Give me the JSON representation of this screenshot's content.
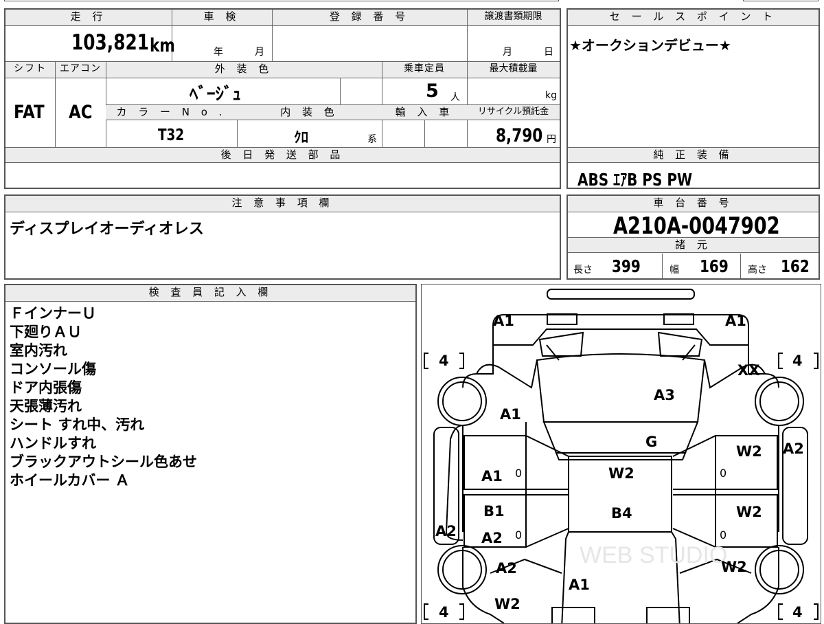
{
  "mileage": {
    "header": "走 行",
    "value": "103,821",
    "unit": "km"
  },
  "inspection": {
    "header": "車 検",
    "year_label": "年",
    "month_label": "月"
  },
  "registration": {
    "header": "登 録 番 号",
    "value": ""
  },
  "transfer": {
    "header": "譲渡書類期限",
    "month_label": "月",
    "day_label": "日"
  },
  "sales_point": {
    "header": "セ ー ル ス ポ イ ン ト",
    "text": "★オークションデビュー★"
  },
  "shift": {
    "header": "シフト",
    "value": "FAT"
  },
  "aircon": {
    "header": "エアコン",
    "value": "AC"
  },
  "exterior_color": {
    "header": "外 装 色",
    "value": "ﾍﾞｰｼﾞｭ"
  },
  "capacity": {
    "header": "乗車定員",
    "value": "5",
    "unit": "人"
  },
  "max_load": {
    "header": "最大積載量",
    "unit": "kg"
  },
  "color_no": {
    "header": "カ ラ ー N o .",
    "value": "T32"
  },
  "interior_color": {
    "header": "内 装 色",
    "value": "ｸﾛ",
    "suffix": "系"
  },
  "import_car": {
    "header": "輸 入 車"
  },
  "recycle": {
    "header": "リサイクル預託金",
    "value": "8,790",
    "unit": "円"
  },
  "later_parts": {
    "header": "後 日 発 送 部 品",
    "text": ""
  },
  "equipment": {
    "header": "純 正 装 備",
    "text": "ABS ｴｱB PS PW"
  },
  "notes": {
    "header": "注 意 事 項 欄",
    "text": "ディスプレイオーディオレス"
  },
  "chassis": {
    "header": "車 台 番 号",
    "value": "A210A-0047902"
  },
  "specs": {
    "header": "諸 元",
    "length_label": "長さ",
    "length": "399",
    "width_label": "幅",
    "width": "169",
    "height_label": "高さ",
    "height": "162"
  },
  "inspector": {
    "header": "検 査 員 記 入 欄",
    "lines": [
      "ＦインナーＵ",
      "下廻りＡＵ",
      "室内汚れ",
      "コンソール傷",
      "ドア内張傷",
      "天張薄汚れ",
      "シート すれ中、汚れ",
      "ハンドルすれ",
      "ブラックアウトシール色あせ",
      "ホイールカバー Ａ"
    ]
  },
  "diagram": {
    "marks": {
      "front_left_corner": "A1",
      "front_right_corner": "A1",
      "hood_left": "A1",
      "windshield": "A3",
      "roof_front": "G",
      "roof": "W2",
      "roof_rear": "B4",
      "right_panel_xx": "XX",
      "front_right_door": "W2",
      "rear_right_door": "W2",
      "right_rear_quarter": "W2",
      "right_fender": "A2",
      "front_left_door": "A1",
      "rear_left_door_b": "B1",
      "rear_left_door_a": "A2",
      "left_side_sill": "A2",
      "left_rear_quarter": "A2",
      "tailgate": "A1",
      "left_rear_bottom": "W2"
    },
    "tires": {
      "front_left": "4",
      "front_right": "4",
      "rear_left": "4",
      "rear_right": "4"
    },
    "door_zeros": [
      "0",
      "0",
      "0",
      "0"
    ],
    "watermark": "WEB STUDIO"
  }
}
